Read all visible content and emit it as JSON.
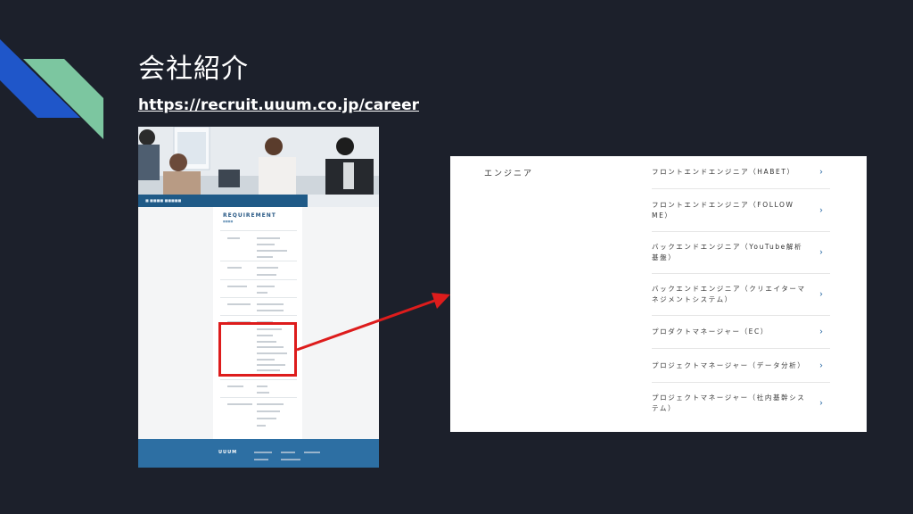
{
  "slide": {
    "title": "会社紹介",
    "link": "https://recruit.uuum.co.jp/career"
  },
  "colors": {
    "background": "#1c202b",
    "accent_blue": "#1f56c9",
    "accent_green": "#7cc6a0",
    "highlight_red": "#dd1c1c"
  },
  "screenshot": {
    "section_title": "REQUIREMENT",
    "footer_logo": "UUUM"
  },
  "panel": {
    "category": "エンジニア",
    "jobs": [
      "フロントエンドエンジニア（HABET）",
      "フロントエンドエンジニア（FOLLOW ME）",
      "バックエンドエンジニア（YouTube解析基盤）",
      "バックエンドエンジニア（クリエイターマネジメントシステム）",
      "プロダクトマネージャー（EC）",
      "プロジェクトマネージャー（データ分析）",
      "プロジェクトマネージャー（社内基幹システム）"
    ],
    "chevron": "›"
  }
}
